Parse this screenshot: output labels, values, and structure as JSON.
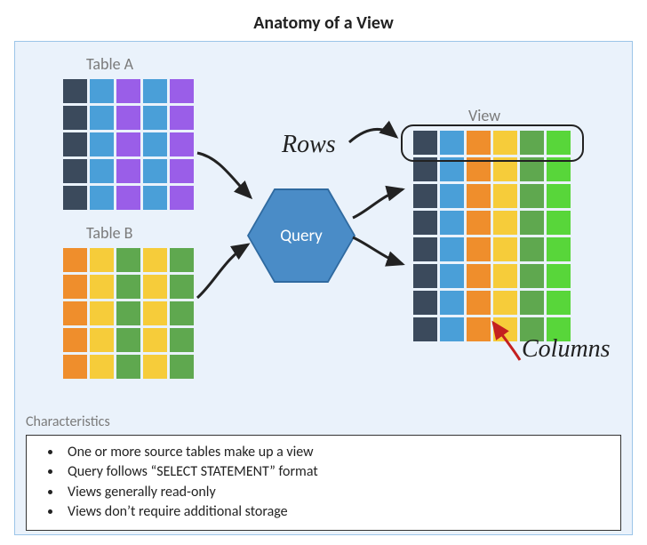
{
  "title": "Anatomy of a View",
  "labels": {
    "table_a": "Table A",
    "table_b": "Table B",
    "view": "View",
    "rows": "Rows",
    "columns": "Columns",
    "query": "Query"
  },
  "characteristics": {
    "heading": "Characteristics",
    "items": [
      "One or more source tables make up a view",
      "Query follows “SELECT STATEMENT” format",
      "Views generally read-only",
      "Views don’t require additional storage"
    ]
  },
  "table_a_columns": [
    "navy",
    "blue",
    "purple",
    "blue",
    "purple"
  ],
  "table_b_columns": [
    "orange",
    "yellow",
    "green",
    "yellow",
    "green"
  ],
  "view_columns": [
    "navy",
    "blue",
    "orange",
    "yellow",
    "green",
    "lime"
  ],
  "colors": {
    "navy": "#3b4a5c",
    "blue": "#4a9fd8",
    "purple": "#9a5ee8",
    "orange": "#ef8e2c",
    "yellow": "#f6cc3a",
    "green": "#5fa84f",
    "lime": "#58d63a",
    "hex": "#4a8cc7",
    "hex_border": "#2f6aa0",
    "panel_bg": "#eaf2fb",
    "panel_border": "#9cc5e8",
    "red_arrow": "#c4201f"
  }
}
